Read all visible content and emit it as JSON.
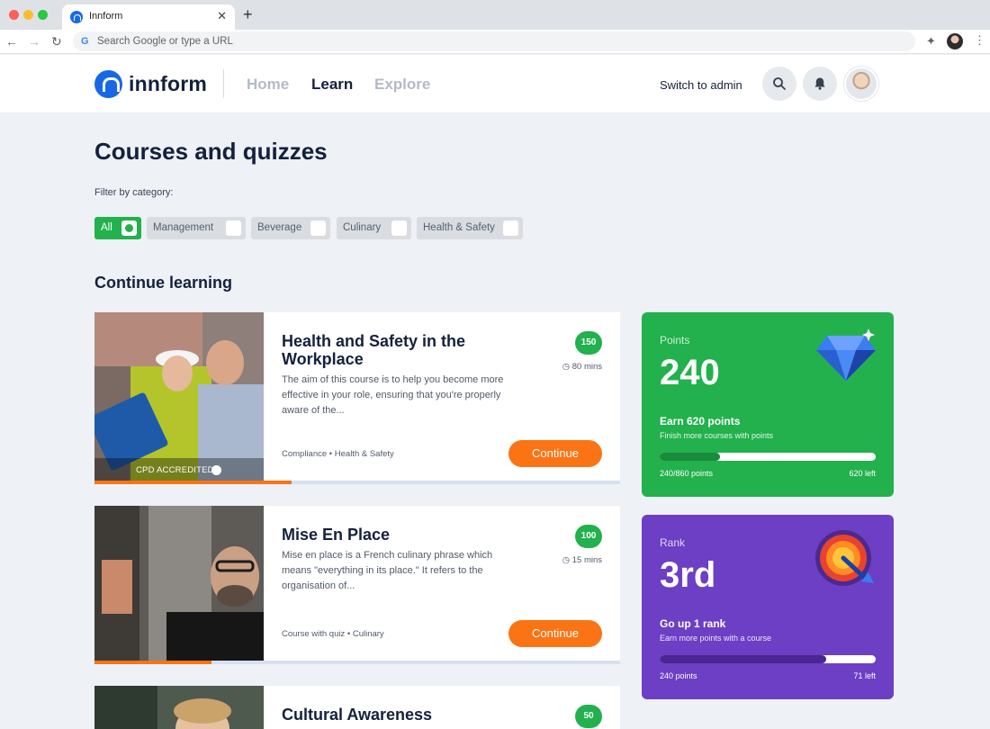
{
  "browser": {
    "tab_title": "Innform",
    "address_placeholder": "Search Google or type a URL"
  },
  "header": {
    "brand": "innform",
    "nav": [
      "Home",
      "Learn",
      "Explore"
    ],
    "active_nav": "Learn",
    "switch_admin": "Switch to admin"
  },
  "main": {
    "title": "Courses and quizzes",
    "filter_label": "Filter by category:",
    "filters": [
      {
        "label": "All",
        "selected": true
      },
      {
        "label": "Management",
        "selected": false
      },
      {
        "label": "Beverage",
        "selected": false
      },
      {
        "label": "Culinary",
        "selected": false
      },
      {
        "label": "Health & Safety",
        "selected": false
      }
    ],
    "section_title": "Continue learning"
  },
  "courses": [
    {
      "title": "Health and Safety in the Workplace",
      "description": "The aim of this course is to help you become more effective in your role, ensuring that you're properly aware of the...",
      "points": "150",
      "duration": "80 mins",
      "meta": "Compliance • Health & Safety",
      "action": "Continue",
      "badge": "CPD ACCREDITED",
      "progress": 0.375
    },
    {
      "title": "Mise En Place",
      "description": "Mise en place is a French culinary phrase which means \"everything in its place.\" It refers to the organisation of...",
      "points": "100",
      "duration": "15 mins",
      "meta": "Course with quiz • Culinary",
      "action": "Continue",
      "progress": 0.223
    },
    {
      "title": "Cultural Awareness",
      "points": "50"
    }
  ],
  "stats": {
    "points": {
      "label": "Points",
      "value": "240",
      "goal": "Earn 620 points",
      "sub": "Finish more courses with points",
      "progress_text": "240/860 points",
      "remaining": "620 left",
      "progress": 0.279,
      "color": "#22b14c"
    },
    "rank": {
      "label": "Rank",
      "value": "3rd",
      "goal": "Go up 1 rank",
      "sub": "Earn more points with a course",
      "progress_text": "240 points",
      "remaining": "71 left",
      "progress": 0.77,
      "color": "#6c3fc4"
    }
  },
  "colors": {
    "accent_orange": "#fa7414",
    "green": "#22b14c",
    "purple": "#6c3fc4",
    "brand_blue": "#1768e6"
  }
}
